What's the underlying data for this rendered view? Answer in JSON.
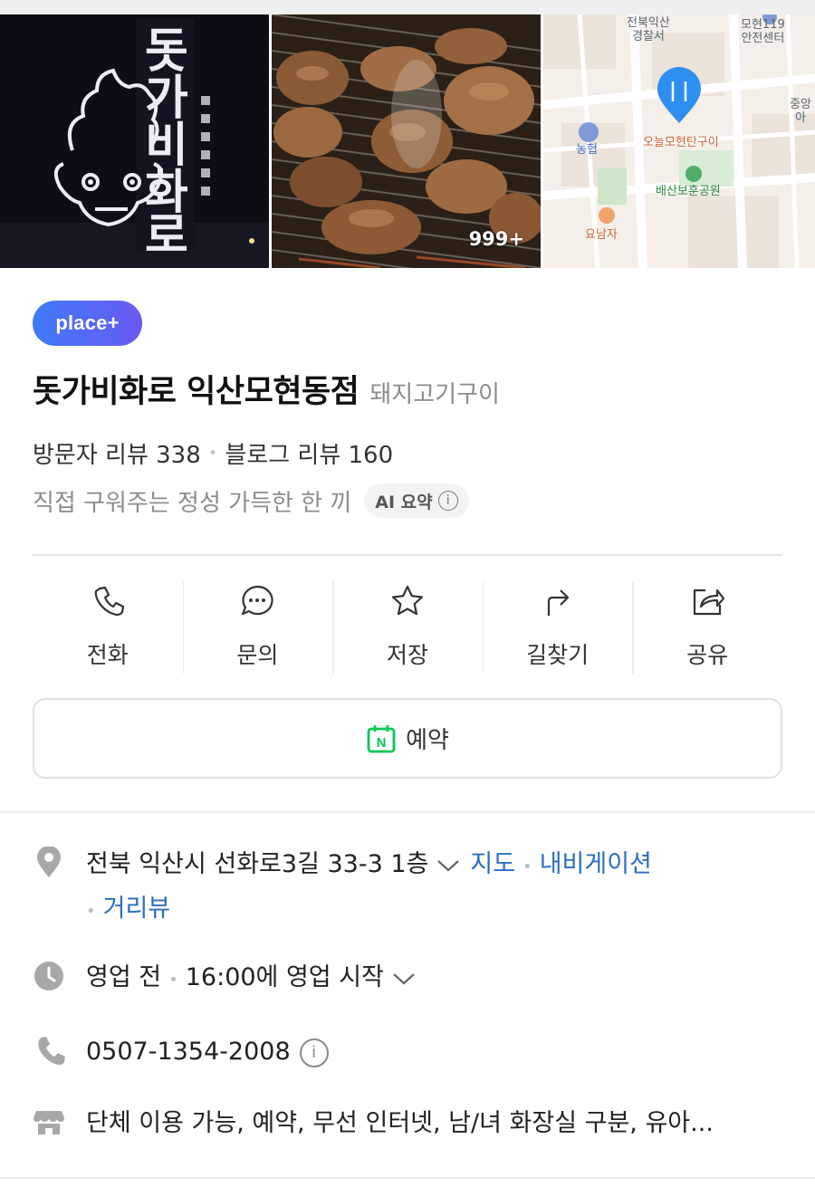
{
  "gallery": {
    "sign_text": [
      "돗",
      "가",
      "비",
      "화",
      "로"
    ],
    "photo_count": "999+",
    "map_labels": {
      "police": "전북익산\n경찰서",
      "safety": "모현119\n안전센터",
      "nonghyup": "농협",
      "restaurant": "오늘모현탄구이",
      "park": "배산보훈공원",
      "yonamja": "요남자",
      "edge": "중앙\n아"
    }
  },
  "place": {
    "badge": "place+",
    "name": "돗가비화로 익산모현동점",
    "category": "돼지고기구이",
    "visitor_reviews": "방문자 리뷰 338",
    "blog_reviews": "블로그 리뷰 160",
    "summary": "직접 구워주는 정성 가득한 한 끼",
    "ai_summary_label": "AI 요약",
    "info_glyph": "i"
  },
  "actions": [
    {
      "label": "전화",
      "icon": "phone-icon"
    },
    {
      "label": "문의",
      "icon": "chat-icon"
    },
    {
      "label": "저장",
      "icon": "star-icon"
    },
    {
      "label": "길찾기",
      "icon": "directions-icon"
    },
    {
      "label": "공유",
      "icon": "share-icon"
    }
  ],
  "reserve": {
    "label": "예약",
    "icon_letter": "N"
  },
  "details": {
    "address": "전북 익산시 선화로3길 33-3 1층",
    "map_link": "지도",
    "navigation_link": "내비게이션",
    "streetview_link": "거리뷰",
    "status": "영업 전",
    "open_time": "16:00에 영업 시작",
    "phone": "0507-1354-2008",
    "amenities": "단체 이용 가능, 예약, 무선 인터넷, 남/녀 화장실 구분, 유아..."
  },
  "colors": {
    "link": "#2b6fbf",
    "badge_start": "#3f7bf7",
    "badge_end": "#6a59f2",
    "naver_green": "#03c75a"
  }
}
